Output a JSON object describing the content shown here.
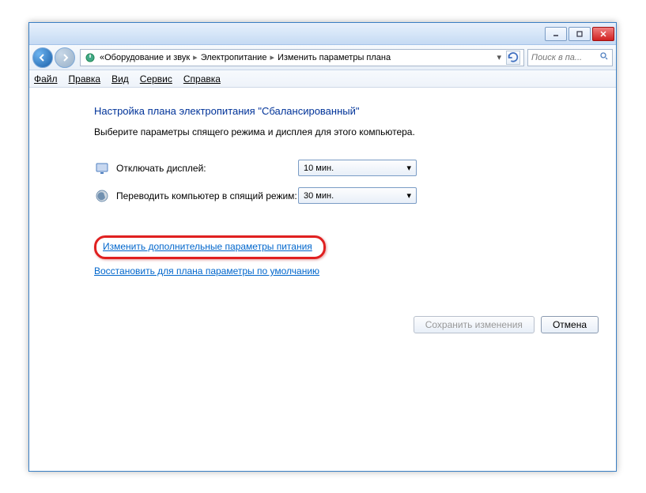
{
  "breadcrumbs": {
    "prefix": "«",
    "items": [
      "Оборудование и звук",
      "Электропитание",
      "Изменить параметры плана"
    ]
  },
  "search": {
    "placeholder": "Поиск в па..."
  },
  "menu": {
    "file": "Файл",
    "edit": "Правка",
    "view": "Вид",
    "tools": "Сервис",
    "help": "Справка"
  },
  "page": {
    "title": "Настройка плана электропитания \"Сбалансированный\"",
    "subtitle": "Выберите параметры спящего режима и дисплея для этого компьютера."
  },
  "settings": {
    "display_off_label": "Отключать дисплей:",
    "display_off_value": "10 мин.",
    "sleep_label": "Переводить компьютер в спящий режим:",
    "sleep_value": "30 мин."
  },
  "links": {
    "advanced": "Изменить дополнительные параметры питания",
    "restore": "Восстановить для плана параметры по умолчанию"
  },
  "buttons": {
    "save": "Сохранить изменения",
    "cancel": "Отмена"
  }
}
